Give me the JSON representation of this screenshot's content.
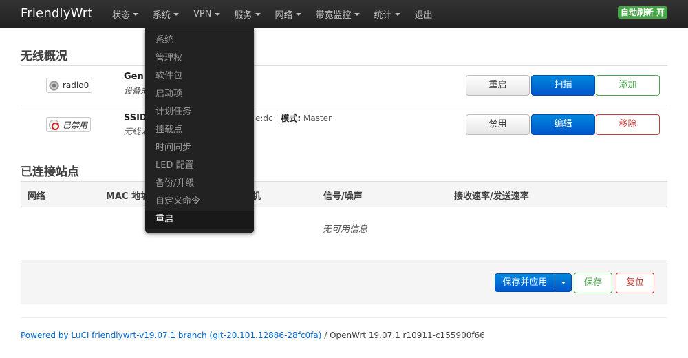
{
  "header": {
    "brand": "FriendlyWrt",
    "menu": [
      {
        "label": "状态",
        "has_caret": true
      },
      {
        "label": "系统",
        "has_caret": true
      },
      {
        "label": "VPN",
        "has_caret": true
      },
      {
        "label": "服务",
        "has_caret": true
      },
      {
        "label": "网络",
        "has_caret": true
      },
      {
        "label": "带宽监控",
        "has_caret": true
      },
      {
        "label": "统计",
        "has_caret": true
      },
      {
        "label": "退出",
        "has_caret": false
      }
    ],
    "auto_refresh": "自动刷新 开"
  },
  "system_dropdown": {
    "items": [
      "系统",
      "管理权",
      "软件包",
      "启动项",
      "计划任务",
      "挂载点",
      "时间同步",
      "LED 配置",
      "备份/升级",
      "自定义命令",
      "重启"
    ],
    "active": "重启"
  },
  "wireless": {
    "title": "无线概况",
    "rows": [
      {
        "badge": "radio0",
        "name": "Gen",
        "sub": "设备未",
        "detail_prefix": "",
        "detail_mode_label": "",
        "detail_mode": "",
        "buttons": [
          "重启",
          "扫描",
          "添加"
        ]
      },
      {
        "badge": "已禁用",
        "name": "SSID",
        "sub": "无线未",
        "detail_prefix": "e:dc |",
        "detail_mode_label": "模式:",
        "detail_mode": "Master",
        "buttons": [
          "禁用",
          "编辑",
          "移除"
        ]
      }
    ]
  },
  "stations": {
    "title": "已连接站点",
    "columns": [
      "网络",
      "MAC 地址",
      "机",
      "信号/噪声",
      "接收速率/发送速率"
    ],
    "empty_text": "无可用信息"
  },
  "actions": {
    "save_apply": "保存并应用",
    "save": "保存",
    "reset": "复位"
  },
  "footer": {
    "link_text": "Powered by LuCI friendlywrt-v19.07.1 branch (git-20.101.12886-28fc0fa)",
    "version_text": "/ OpenWrt 19.07.1 r10911-c155900f66"
  }
}
